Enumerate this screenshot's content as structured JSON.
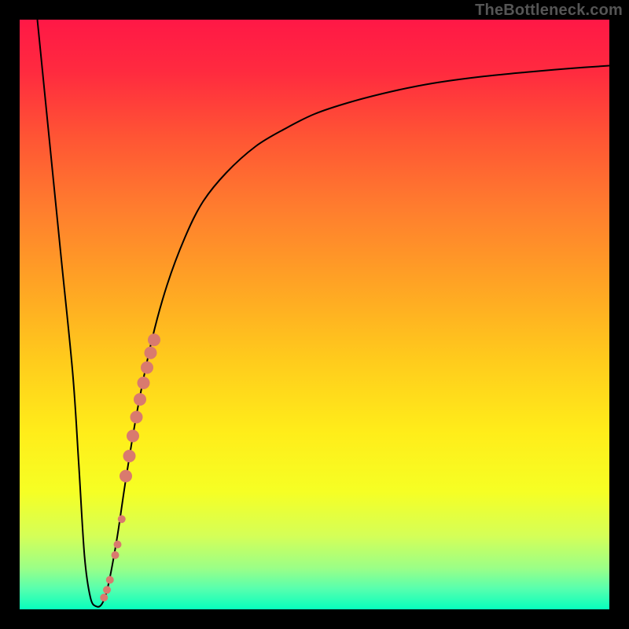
{
  "watermark": "TheBottleneck.com",
  "colors": {
    "frame": "#000000",
    "curve": "#000000",
    "dot": "#d97a6e",
    "gradient": [
      {
        "offset": 0.0,
        "color": "#ff1846"
      },
      {
        "offset": 0.09,
        "color": "#ff2b3f"
      },
      {
        "offset": 0.2,
        "color": "#ff5534"
      },
      {
        "offset": 0.32,
        "color": "#ff7d2e"
      },
      {
        "offset": 0.45,
        "color": "#ffa424"
      },
      {
        "offset": 0.58,
        "color": "#ffcc1c"
      },
      {
        "offset": 0.7,
        "color": "#ffed1a"
      },
      {
        "offset": 0.8,
        "color": "#f6ff24"
      },
      {
        "offset": 0.875,
        "color": "#d5ff57"
      },
      {
        "offset": 0.93,
        "color": "#9bff87"
      },
      {
        "offset": 0.965,
        "color": "#57ffae"
      },
      {
        "offset": 1.0,
        "color": "#06ffbd"
      }
    ]
  },
  "chart_data": {
    "type": "line",
    "title": "",
    "xlabel": "",
    "ylabel": "",
    "xlim": [
      0,
      100
    ],
    "ylim": [
      0,
      100
    ],
    "series": [
      {
        "name": "bottleneck-curve",
        "x": [
          3,
          5,
          7,
          9,
          10,
          11,
          12,
          13,
          14,
          15,
          16.5,
          18,
          20,
          22.5,
          25,
          28,
          31,
          35,
          40,
          45,
          50,
          56,
          63,
          70,
          78,
          86,
          93,
          100
        ],
        "values": [
          100,
          80,
          60,
          40,
          25,
          9,
          2,
          0.5,
          1,
          4,
          12,
          22,
          34,
          46,
          55,
          63,
          69,
          74,
          78.5,
          81.5,
          84,
          86,
          87.8,
          89.2,
          90.3,
          91.1,
          91.7,
          92.2
        ]
      }
    ],
    "scatter": {
      "name": "highlight-dots",
      "points": [
        {
          "x": 14.3,
          "y": 2.0,
          "r": 5
        },
        {
          "x": 14.8,
          "y": 3.3,
          "r": 5
        },
        {
          "x": 15.3,
          "y": 5.0,
          "r": 5
        },
        {
          "x": 16.2,
          "y": 9.2,
          "r": 5
        },
        {
          "x": 16.6,
          "y": 11.0,
          "r": 5
        },
        {
          "x": 17.3,
          "y": 15.3,
          "r": 5
        },
        {
          "x": 18.0,
          "y": 22.6,
          "r": 8
        },
        {
          "x": 18.6,
          "y": 26.0,
          "r": 8
        },
        {
          "x": 19.2,
          "y": 29.4,
          "r": 8
        },
        {
          "x": 19.8,
          "y": 32.6,
          "r": 8
        },
        {
          "x": 20.4,
          "y": 35.6,
          "r": 8
        },
        {
          "x": 21.0,
          "y": 38.4,
          "r": 8
        },
        {
          "x": 21.6,
          "y": 41.0,
          "r": 8
        },
        {
          "x": 22.2,
          "y": 43.5,
          "r": 8
        },
        {
          "x": 22.8,
          "y": 45.7,
          "r": 8
        }
      ]
    }
  }
}
